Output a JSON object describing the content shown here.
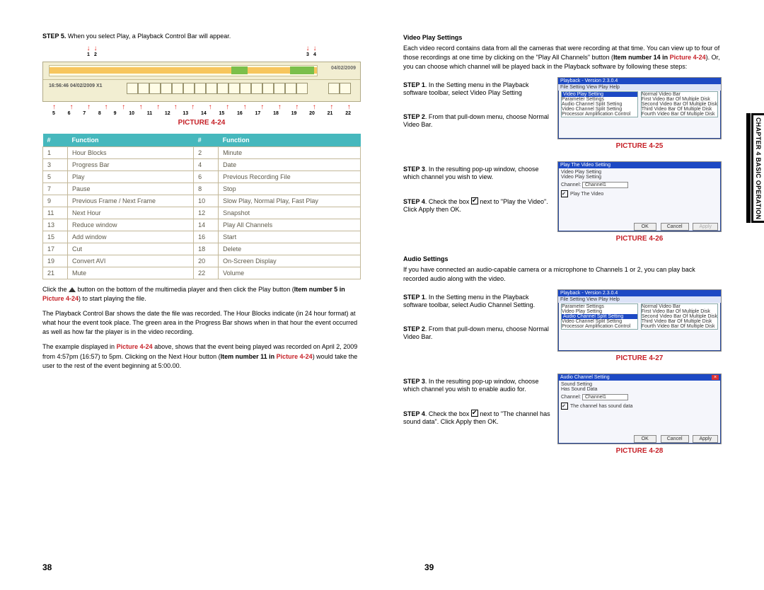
{
  "left": {
    "step5": {
      "prefix": "STEP 5.",
      "body": " When you select Play, a Playback Control Bar will appear."
    },
    "date": "04/02/2009",
    "timestamp": "16:56:46 04/02/2009 X1",
    "top_arrow_labels": [
      "1",
      "2",
      "3",
      "4"
    ],
    "bot_arrow_labels": [
      "5",
      "6",
      "7",
      "8",
      "9",
      "10",
      "11",
      "12",
      "13",
      "14",
      "15",
      "16",
      "17",
      "18",
      "19",
      "20",
      "21",
      "22"
    ],
    "picture_caption": "PICTURE 4-24",
    "table": {
      "h1": "#",
      "h2": "Function",
      "h3": "#",
      "h4": "Function",
      "rows": [
        {
          "a": "1",
          "af": "Hour Blocks",
          "b": "2",
          "bf": "Minute"
        },
        {
          "a": "3",
          "af": "Progress Bar",
          "b": "4",
          "bf": "Date"
        },
        {
          "a": "5",
          "af": "Play",
          "b": "6",
          "bf": "Previous Recording File"
        },
        {
          "a": "7",
          "af": "Pause",
          "b": "8",
          "bf": "Stop"
        },
        {
          "a": "9",
          "af": "Previous Frame / Next Frame",
          "b": "10",
          "bf": "Slow Play, Normal Play, Fast Play"
        },
        {
          "a": "11",
          "af": "Next Hour",
          "b": "12",
          "bf": "Snapshot"
        },
        {
          "a": "13",
          "af": "Reduce window",
          "b": "14",
          "bf": "Play All Channels"
        },
        {
          "a": "15",
          "af": "Add window",
          "b": "16",
          "bf": "Start"
        },
        {
          "a": "17",
          "af": "Cut",
          "b": "18",
          "bf": "Delete"
        },
        {
          "a": "19",
          "af": "Convert AVI",
          "b": "20",
          "bf": "On-Screen Display"
        },
        {
          "a": "21",
          "af": "Mute",
          "b": "22",
          "bf": "Volume"
        }
      ]
    },
    "para1_a": "Click the ",
    "para1_b": " button on the bottom of the multimedia player and then click the Play button (",
    "para1_item": "Item number 5 in ",
    "para1_pic": "Picture 4-24",
    "para1_c": ") to start playing the file.",
    "para2_a": "The Playback Control Bar shows the date the file was recorded. The Hour Blocks indicate (in 24 hour format) at what hour the event took place. The green area in the Progress Bar shows when in that hour the event occurred as well as how far the player is in the video recording.",
    "para3_a": "The example displayed in ",
    "para3_pic": "Picture 4-24",
    "para3_b": " above, shows that the event being played was recorded on April 2, 2009 from 4:57pm (16:57) to 5pm. Clicking on the Next Hour button (",
    "para3_item": "Item number 11 in ",
    "para3_pic2": "Picture 4-24",
    "para3_c": ") would take the user to the rest of the event beginning at 5:00.00.",
    "page_number": "38"
  },
  "right": {
    "vps_title": "Video Play Settings",
    "vps_intro_a": "Each video record contains data from all the cameras that were recording at that time. You can view up to four of those recordings at one time by clicking on the \"Play All Channels\" button (",
    "vps_item": "Item number 14 in ",
    "vps_pic": "Picture 4-24",
    "vps_intro_b": "). Or, you can choose which channel will be played back in the Playback software by following these steps:",
    "steps_vps": {
      "s1p": "STEP 1",
      "s1": ". In the Setting menu in the Playback software toolbar, select Video Play Setting",
      "s2p": "STEP 2",
      "s2": ". From that pull-down menu, choose Normal Video Bar.",
      "s3p": "STEP 3",
      "s3": ". In the resulting pop-up window, choose which channel you wish to view.",
      "s4p": "STEP 4",
      "s4a": ". Check the box ",
      "s4b": " next to \"Play the Video\". Click Apply then OK."
    },
    "pic25": "PICTURE 4-25",
    "pic26": "PICTURE 4-26",
    "aud_title": "Audio Settings",
    "aud_intro": "If you have connected an audio-capable camera or a microphone to Channels 1 or 2, you can play back recorded audio along with the video.",
    "steps_aud": {
      "s1p": "STEP 1",
      "s1": ". In the Setting menu in the Playback software toolbar, select Audio Channel Setting.",
      "s2p": "STEP 2",
      "s2": ". From that pull-down menu, choose Normal Video Bar.",
      "s3p": "STEP 3",
      "s3": ". In the resulting pop-up window, choose which channel you wish to enable audio for.",
      "s4p": "STEP 4",
      "s4a": ". Check the box ",
      "s4b": " next to \"The channel has sound data\". Click Apply then OK."
    },
    "pic27": "PICTURE 4-27",
    "pic28": "PICTURE 4-28",
    "page_number": "39",
    "side_label": "CHAPTER 4  BASIC OPERATION",
    "shot25": {
      "title": "Playback - Version 2.3.0.4",
      "menu": "File   Setting   View   Play   Help",
      "items": [
        "Parameter Settings",
        "Video Play Setting",
        "Audio Channel Split Setting",
        "Video Channel Split Setting",
        "Processor Amplification Control"
      ],
      "right": [
        "Normal Video Bar",
        "First Video Bar Of Multiple Disk",
        "Second Video Bar Of Multiple Disk",
        "Third Video Bar Of Multiple Disk",
        "Fourth Video Bar Of Multiple Disk"
      ]
    },
    "shot26": {
      "title": "Play The Video Setting",
      "l1": "Video Play Setting",
      "l2": "Video Play Setting",
      "ch": "Channel:",
      "chv": "Channel1",
      "cb": "Play The Video",
      "ok": "OK",
      "cancel": "Cancel",
      "apply": "Apply"
    },
    "shot27": {
      "title": "Playback - Version 2.3.0.4",
      "menu": "File   Setting   View   Play   Help",
      "items": [
        "Parameter Settings",
        "Video Play Setting",
        "Audio Channel Split Setting",
        "Video Channel Split Setting",
        "Processor Amplification Control"
      ],
      "right": [
        "Normal Video Bar",
        "First Video Bar Of Multiple Disk",
        "Second Video Bar Of Multiple Disk",
        "Third Video Bar Of Multiple Disk",
        "Fourth Video Bar Of Multiple Disk"
      ]
    },
    "shot28": {
      "title": "Audio Channel Setting",
      "l1": "Sound Setting",
      "l2": "Has Sound Data",
      "ch": "Channel:",
      "chv": "Channel1",
      "cb": "The channel has sound data",
      "ok": "OK",
      "cancel": "Cancel",
      "apply": "Apply"
    }
  }
}
